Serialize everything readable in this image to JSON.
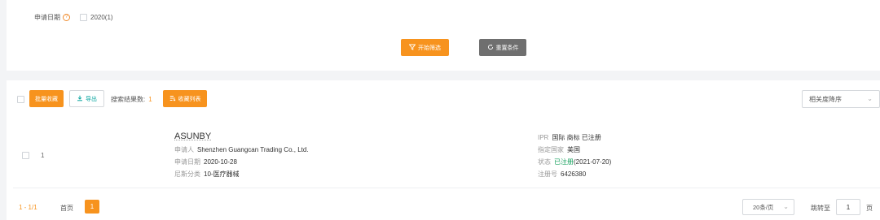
{
  "filter": {
    "label": "申请日期",
    "help_icon": "?",
    "option": "2020(1)",
    "start_button": "开始筛选",
    "reset_button": "重置条件"
  },
  "toolbar": {
    "batch_collect": "批量收藏",
    "export": "导出",
    "result_count_label": "搜索结果数:",
    "result_count": "1",
    "collect_list": "收藏列表",
    "sort_value": "相关度降序"
  },
  "record": {
    "index": "1",
    "title": "ASUNBY",
    "applicant_label": "申请人",
    "applicant": "Shenzhen Guangcan Trading Co., Ltd.",
    "apply_date_label": "申请日期",
    "apply_date": "2020-10-28",
    "nice_label": "尼斯分类",
    "nice_class": "10-医疗器械",
    "ipr_label": "IPR",
    "ipr": "国际 商标 已注册",
    "country_label": "指定国家",
    "country": "美国",
    "status_label": "状态",
    "status_value": "已注册",
    "status_date": "(2021-07-20)",
    "reg_no_label": "注册号",
    "reg_no": "6426380"
  },
  "pager": {
    "range": "1 - 1/1",
    "first": "首页",
    "current": "1",
    "page_size": "20条/页",
    "jump_label": "跳转至",
    "jump_value": "1",
    "jump_suffix": "页"
  },
  "colors": {
    "accent": "#f7931e",
    "reset_gray": "#6f6f6f",
    "status_green": "#19a15f",
    "export_teal": "#0aa6a0"
  },
  "icons": [
    "help-icon",
    "filter-icon",
    "refresh-icon",
    "download-icon",
    "list-icon",
    "chevron-down-icon"
  ]
}
